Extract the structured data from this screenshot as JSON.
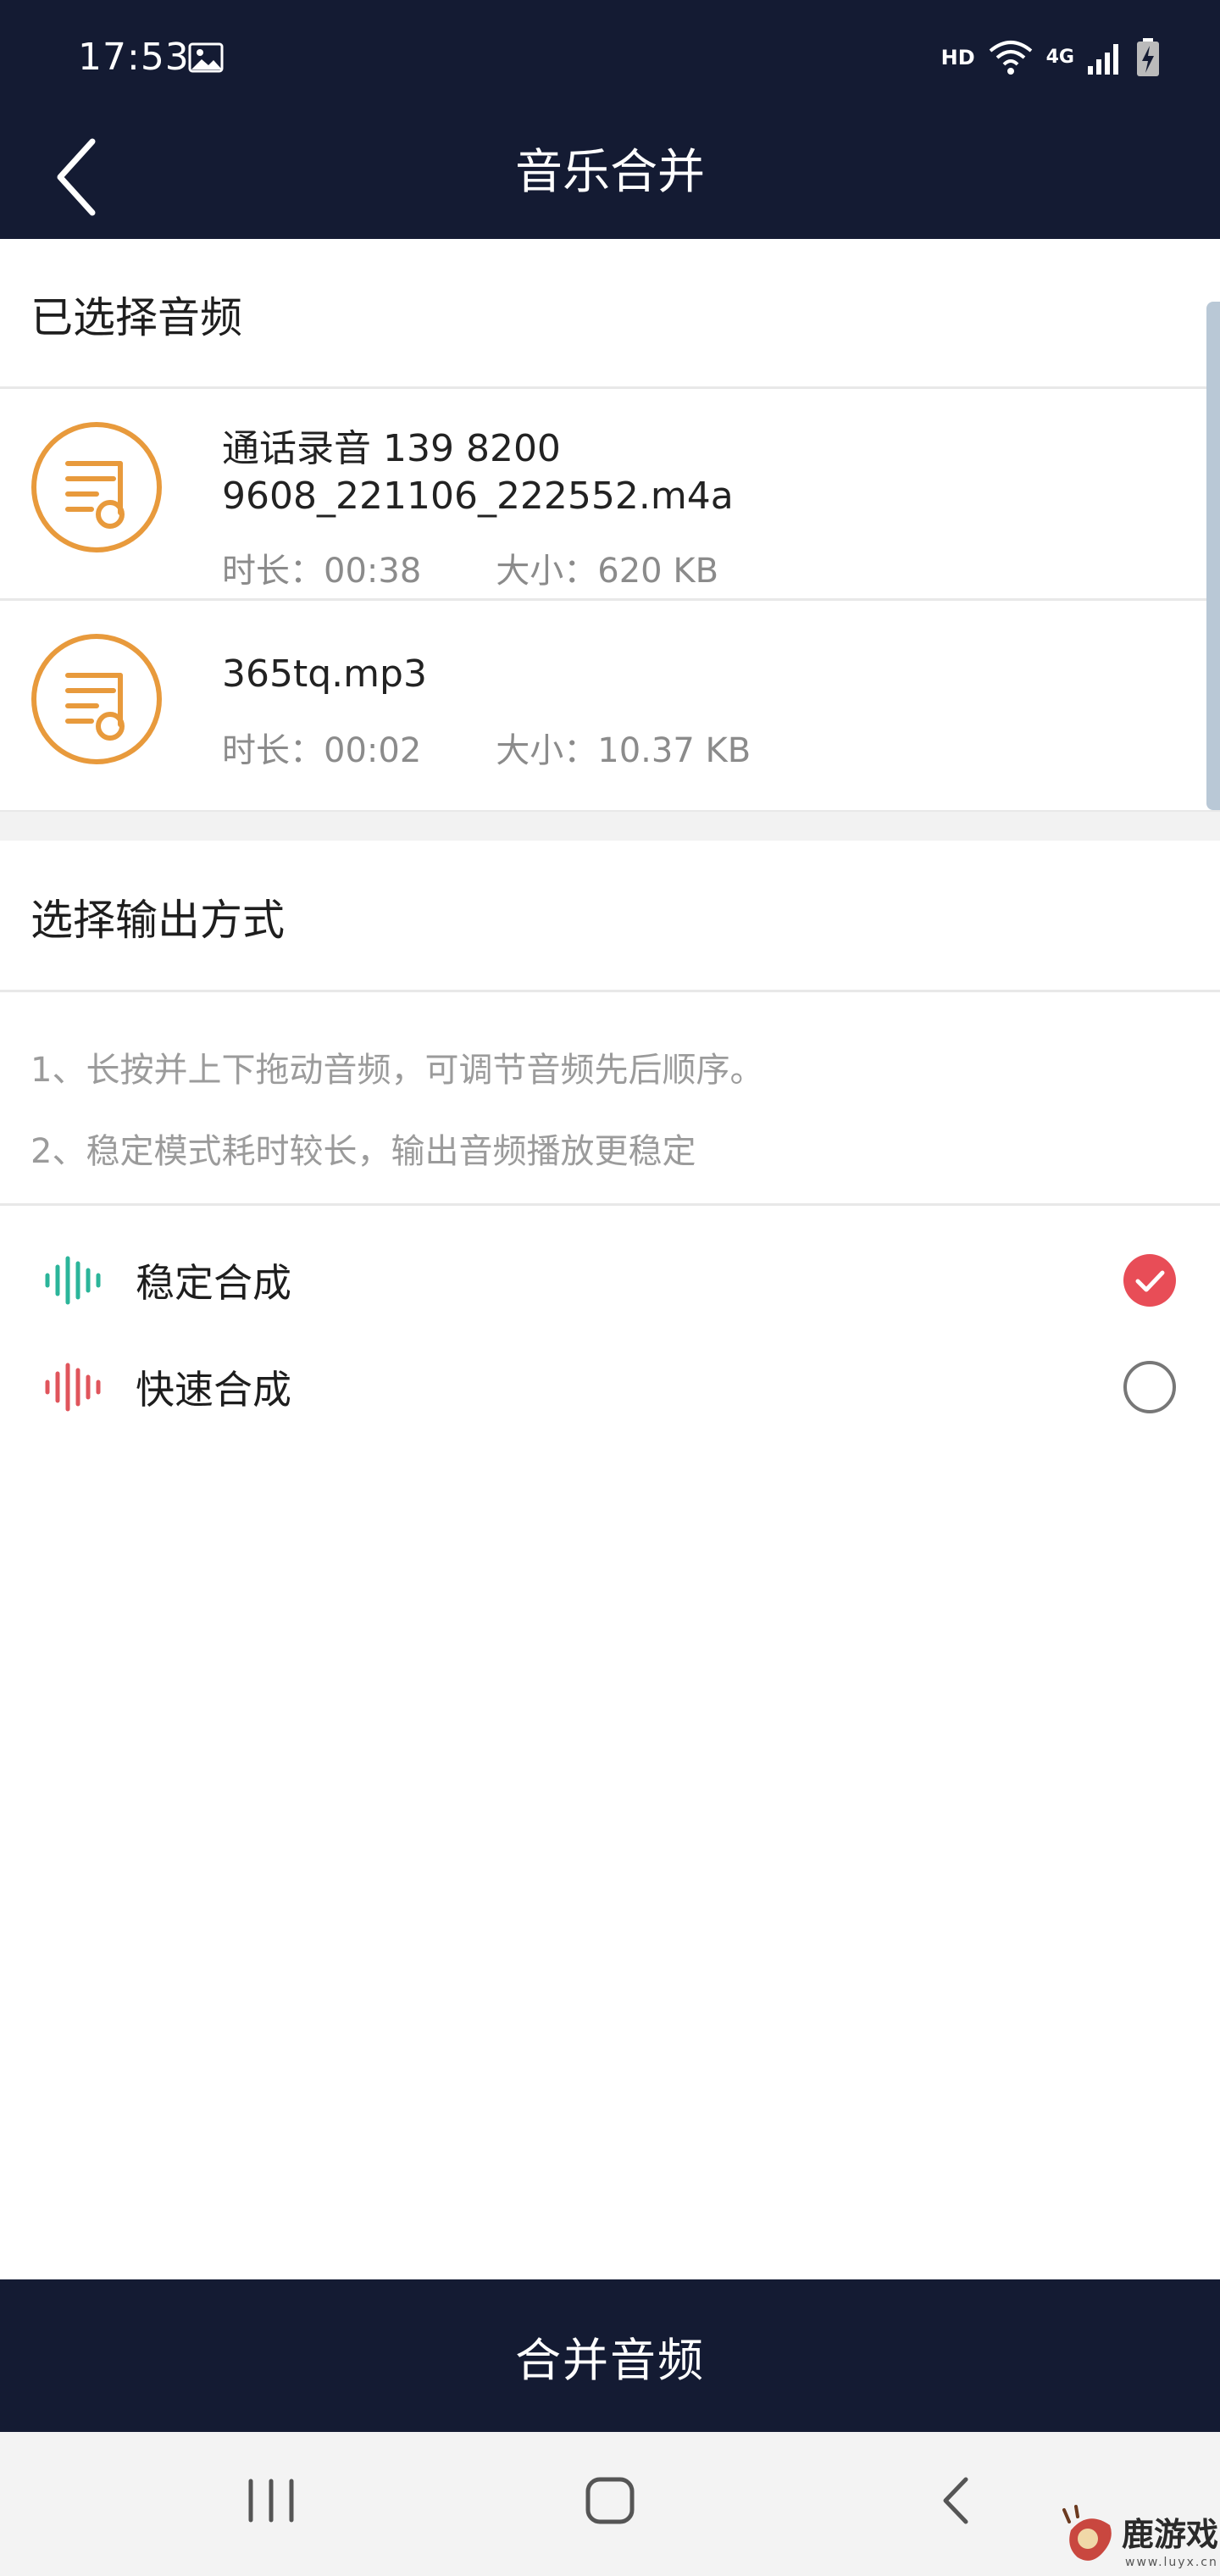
{
  "status_bar": {
    "time": "17:53",
    "hd_label": "HD",
    "network_label": "4G",
    "icons": [
      "image-icon",
      "wifi-icon",
      "signal-icon",
      "battery-charging-icon"
    ]
  },
  "header": {
    "title": "音乐合并",
    "back_icon": "chevron-left-icon"
  },
  "selected_section": {
    "title": "已选择音频",
    "items": [
      {
        "name_line1": "通话录音 139 8200",
        "name_line2": "9608_221106_222552.m4a",
        "duration": "时长：00:38",
        "size": "大小：620 KB",
        "icon": "music-note-icon"
      },
      {
        "name_line1": "365tq.mp3",
        "duration": "时长：00:02",
        "size": "大小：10.37 KB",
        "icon": "music-note-icon"
      }
    ]
  },
  "output_section": {
    "title": "选择输出方式",
    "tips": [
      "1、长按并上下拖动音频，可调节音频先后顺序。",
      "2、稳定模式耗时较长，输出音频播放更稳定"
    ],
    "options": [
      {
        "label": "稳定合成",
        "selected": true,
        "icon": "waveform-icon",
        "color": "#2bb59a"
      },
      {
        "label": "快速合成",
        "selected": false,
        "icon": "waveform-icon",
        "color": "#e0555c"
      }
    ]
  },
  "merge_button": {
    "label": "合并音频"
  },
  "nav_bar": {
    "icons": [
      "recent-apps-icon",
      "home-icon",
      "back-icon"
    ]
  },
  "watermark": {
    "text": "鹿游戏",
    "url": "www.luyx.cn"
  },
  "colors": {
    "header_bg": "#141b33",
    "accent_orange": "#e89a3c",
    "selected_red": "#e84d57",
    "stable_green": "#2bb59a",
    "fast_red": "#e0555c"
  }
}
